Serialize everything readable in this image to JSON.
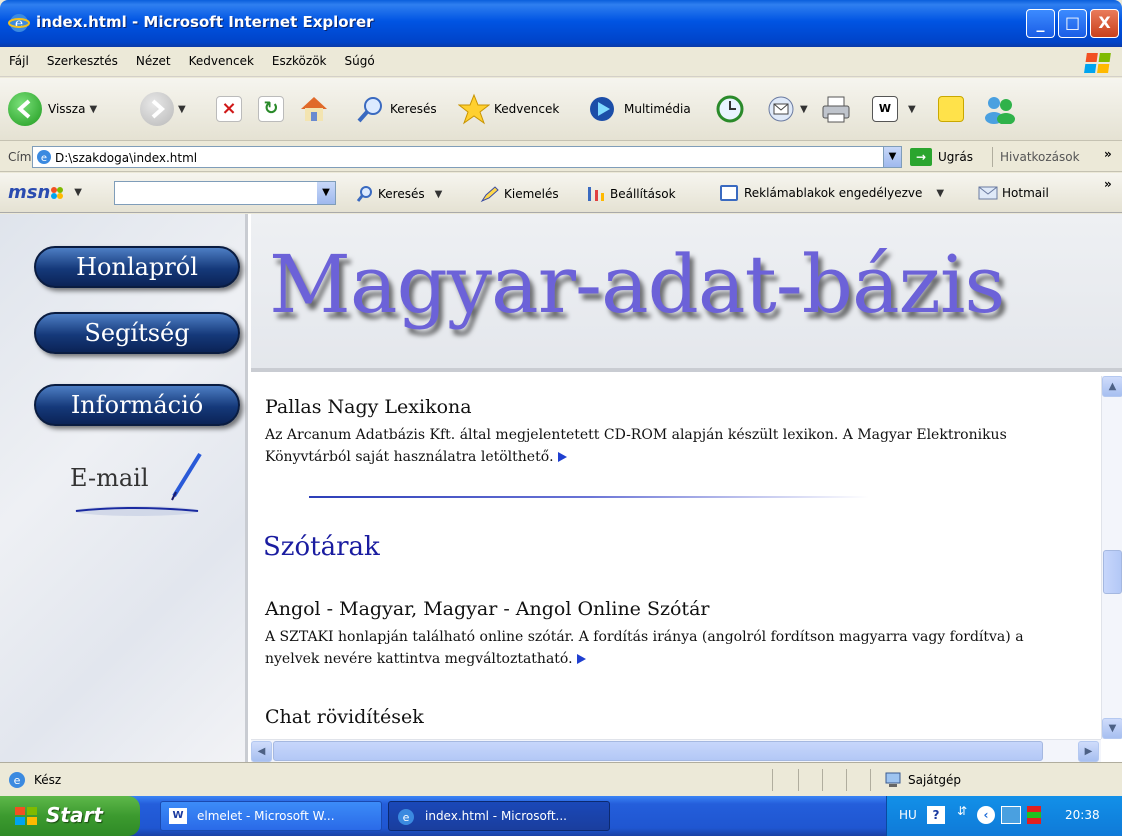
{
  "window": {
    "title": "index.html - Microsoft Internet Explorer",
    "minimize": "_",
    "maximize": "□",
    "close": "X"
  },
  "menu": [
    "Fájl",
    "Szerkesztés",
    "Nézet",
    "Kedvencek",
    "Eszközök",
    "Súgó"
  ],
  "toolbar": {
    "back": "Vissza",
    "search": "Keresés",
    "favorites": "Kedvencek",
    "media": "Multimédia"
  },
  "address": {
    "label": "Cím",
    "url": "D:\\szakdoga\\index.html",
    "go": "Ugrás",
    "links": "Hivatkozások",
    "more": "»"
  },
  "msn": {
    "logo": "msn",
    "search": "Keresés",
    "highlight": "Kiemelés",
    "settings": "Beállítások",
    "popups": "Reklámablakok engedélyezve",
    "hotmail": "Hotmail",
    "more": "»"
  },
  "page": {
    "site_title": "Magyar-adat-bázis",
    "nav": [
      "Honlapról",
      "Segítség",
      "Információ"
    ],
    "email": "E-mail",
    "entries": {
      "pallas_title": "Pallas Nagy Lexikona",
      "pallas_text": "Az Arcanum Adatbázis Kft. által megjelentetett CD-ROM alapján készült lexikon. A Magyar Elektronikus Könyvtárból saját használatra letölthető.",
      "section_title": "Szótárak",
      "angol_title": "Angol - Magyar, Magyar - Angol Online Szótár",
      "angol_text": "A SZTAKI honlapján található online szótár. A fordítás iránya (angolról fordítson magyarra vagy fordítva) a nyelvek nevére kattintva megváltoztatható.",
      "chat_title": "Chat rövidítések"
    }
  },
  "status": {
    "text": "Kész",
    "zone": "Sajátgép"
  },
  "taskbar": {
    "start": "Start",
    "items": [
      "elmelet - Microsoft W...",
      "index.html - Microsoft..."
    ],
    "lang": "HU",
    "clock": "20:38"
  },
  "colors": {
    "title_blue": "#0054e3",
    "nav_button": "#15397a",
    "site_title": "#6c62d8",
    "section_heading": "#1a1ca0",
    "start_green": "#3c9a2f"
  }
}
